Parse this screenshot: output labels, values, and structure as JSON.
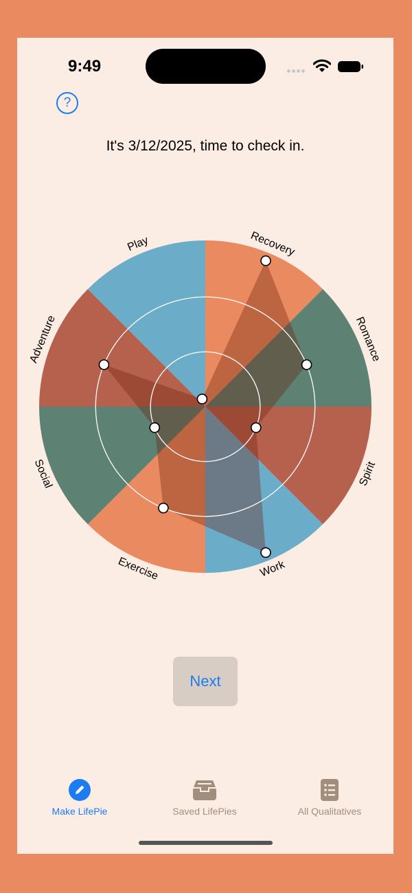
{
  "status_bar": {
    "time": "9:49"
  },
  "header": {
    "help_icon": "question-circle-icon",
    "help_glyph": "?"
  },
  "checkin": {
    "text": "It's 3/12/2025, time to check in."
  },
  "pie": {
    "categories": [
      {
        "label": "Recovery",
        "color": "#E98A60",
        "value": 0.95
      },
      {
        "label": "Romance",
        "color": "#5D8172",
        "value": 0.66
      },
      {
        "label": "Spirit",
        "color": "#B5614E",
        "value": 0.33
      },
      {
        "label": "Work",
        "color": "#6BACC9",
        "value": 0.95
      },
      {
        "label": "Exercise",
        "color": "#E98A60",
        "value": 0.66
      },
      {
        "label": "Social",
        "color": "#5D8172",
        "value": 0.33
      },
      {
        "label": "Adventure",
        "color": "#B5614E",
        "value": 0.66
      },
      {
        "label": "Play",
        "color": "#6BACC9",
        "value": 0.05
      }
    ]
  },
  "actions": {
    "next_label": "Next"
  },
  "tabs": [
    {
      "label": "Make LifePie",
      "icon": "pencil-circle-icon",
      "active": true,
      "color": "#1C7CF0"
    },
    {
      "label": "Saved LifePies",
      "icon": "tray-icon",
      "active": false,
      "color": "#A18F7D"
    },
    {
      "label": "All Qualitatives",
      "icon": "list-doc-icon",
      "active": false,
      "color": "#A18F7D"
    }
  ]
}
